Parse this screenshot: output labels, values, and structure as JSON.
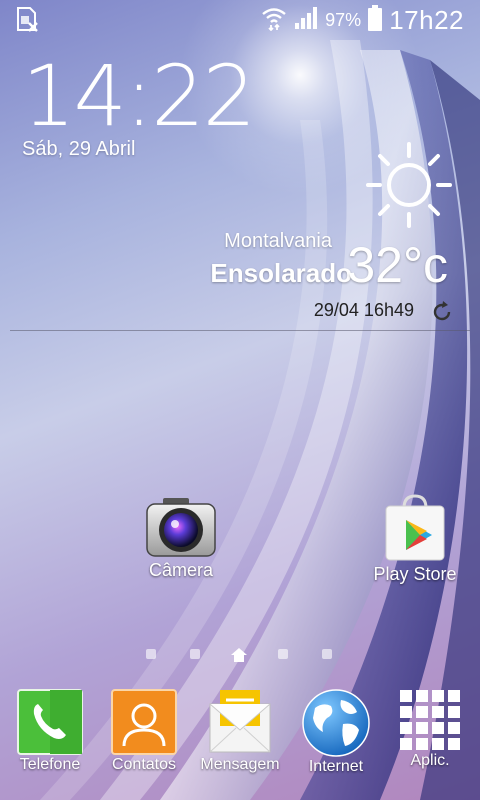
{
  "status_bar": {
    "battery_percent": "97%",
    "battery_level": 0.97,
    "time": "17h22",
    "icons": [
      "sim-card-absent-icon",
      "wifi-icon",
      "signal-icon",
      "battery-icon"
    ]
  },
  "clock_widget": {
    "time": "14:22",
    "date": "Sáb, 29 Abril"
  },
  "weather_widget": {
    "location": "Montalvania",
    "condition": "Ensolarado",
    "temperature": "32°c",
    "updated": "29/04 16h49",
    "icon": "sun-icon"
  },
  "home_apps": [
    {
      "label": "Câmera",
      "icon": "camera-icon"
    },
    {
      "label": "Play Store",
      "icon": "play-store-icon"
    }
  ],
  "page_indicator": {
    "pages": 5,
    "current_label": "home",
    "home_index": 2
  },
  "dock": [
    {
      "label": "Telefone",
      "icon": "phone-icon"
    },
    {
      "label": "Contatos",
      "icon": "contacts-icon"
    },
    {
      "label": "Mensagem",
      "icon": "message-icon"
    },
    {
      "label": "Internet",
      "icon": "globe-icon"
    },
    {
      "label": "Aplic.",
      "icon": "apps-grid-icon"
    }
  ],
  "colors": {
    "phone_green": "#4bbf3a",
    "contacts_orange": "#f28c1e",
    "message_yellow": "#f6c400",
    "internet_blue": "#1a7fd8"
  }
}
